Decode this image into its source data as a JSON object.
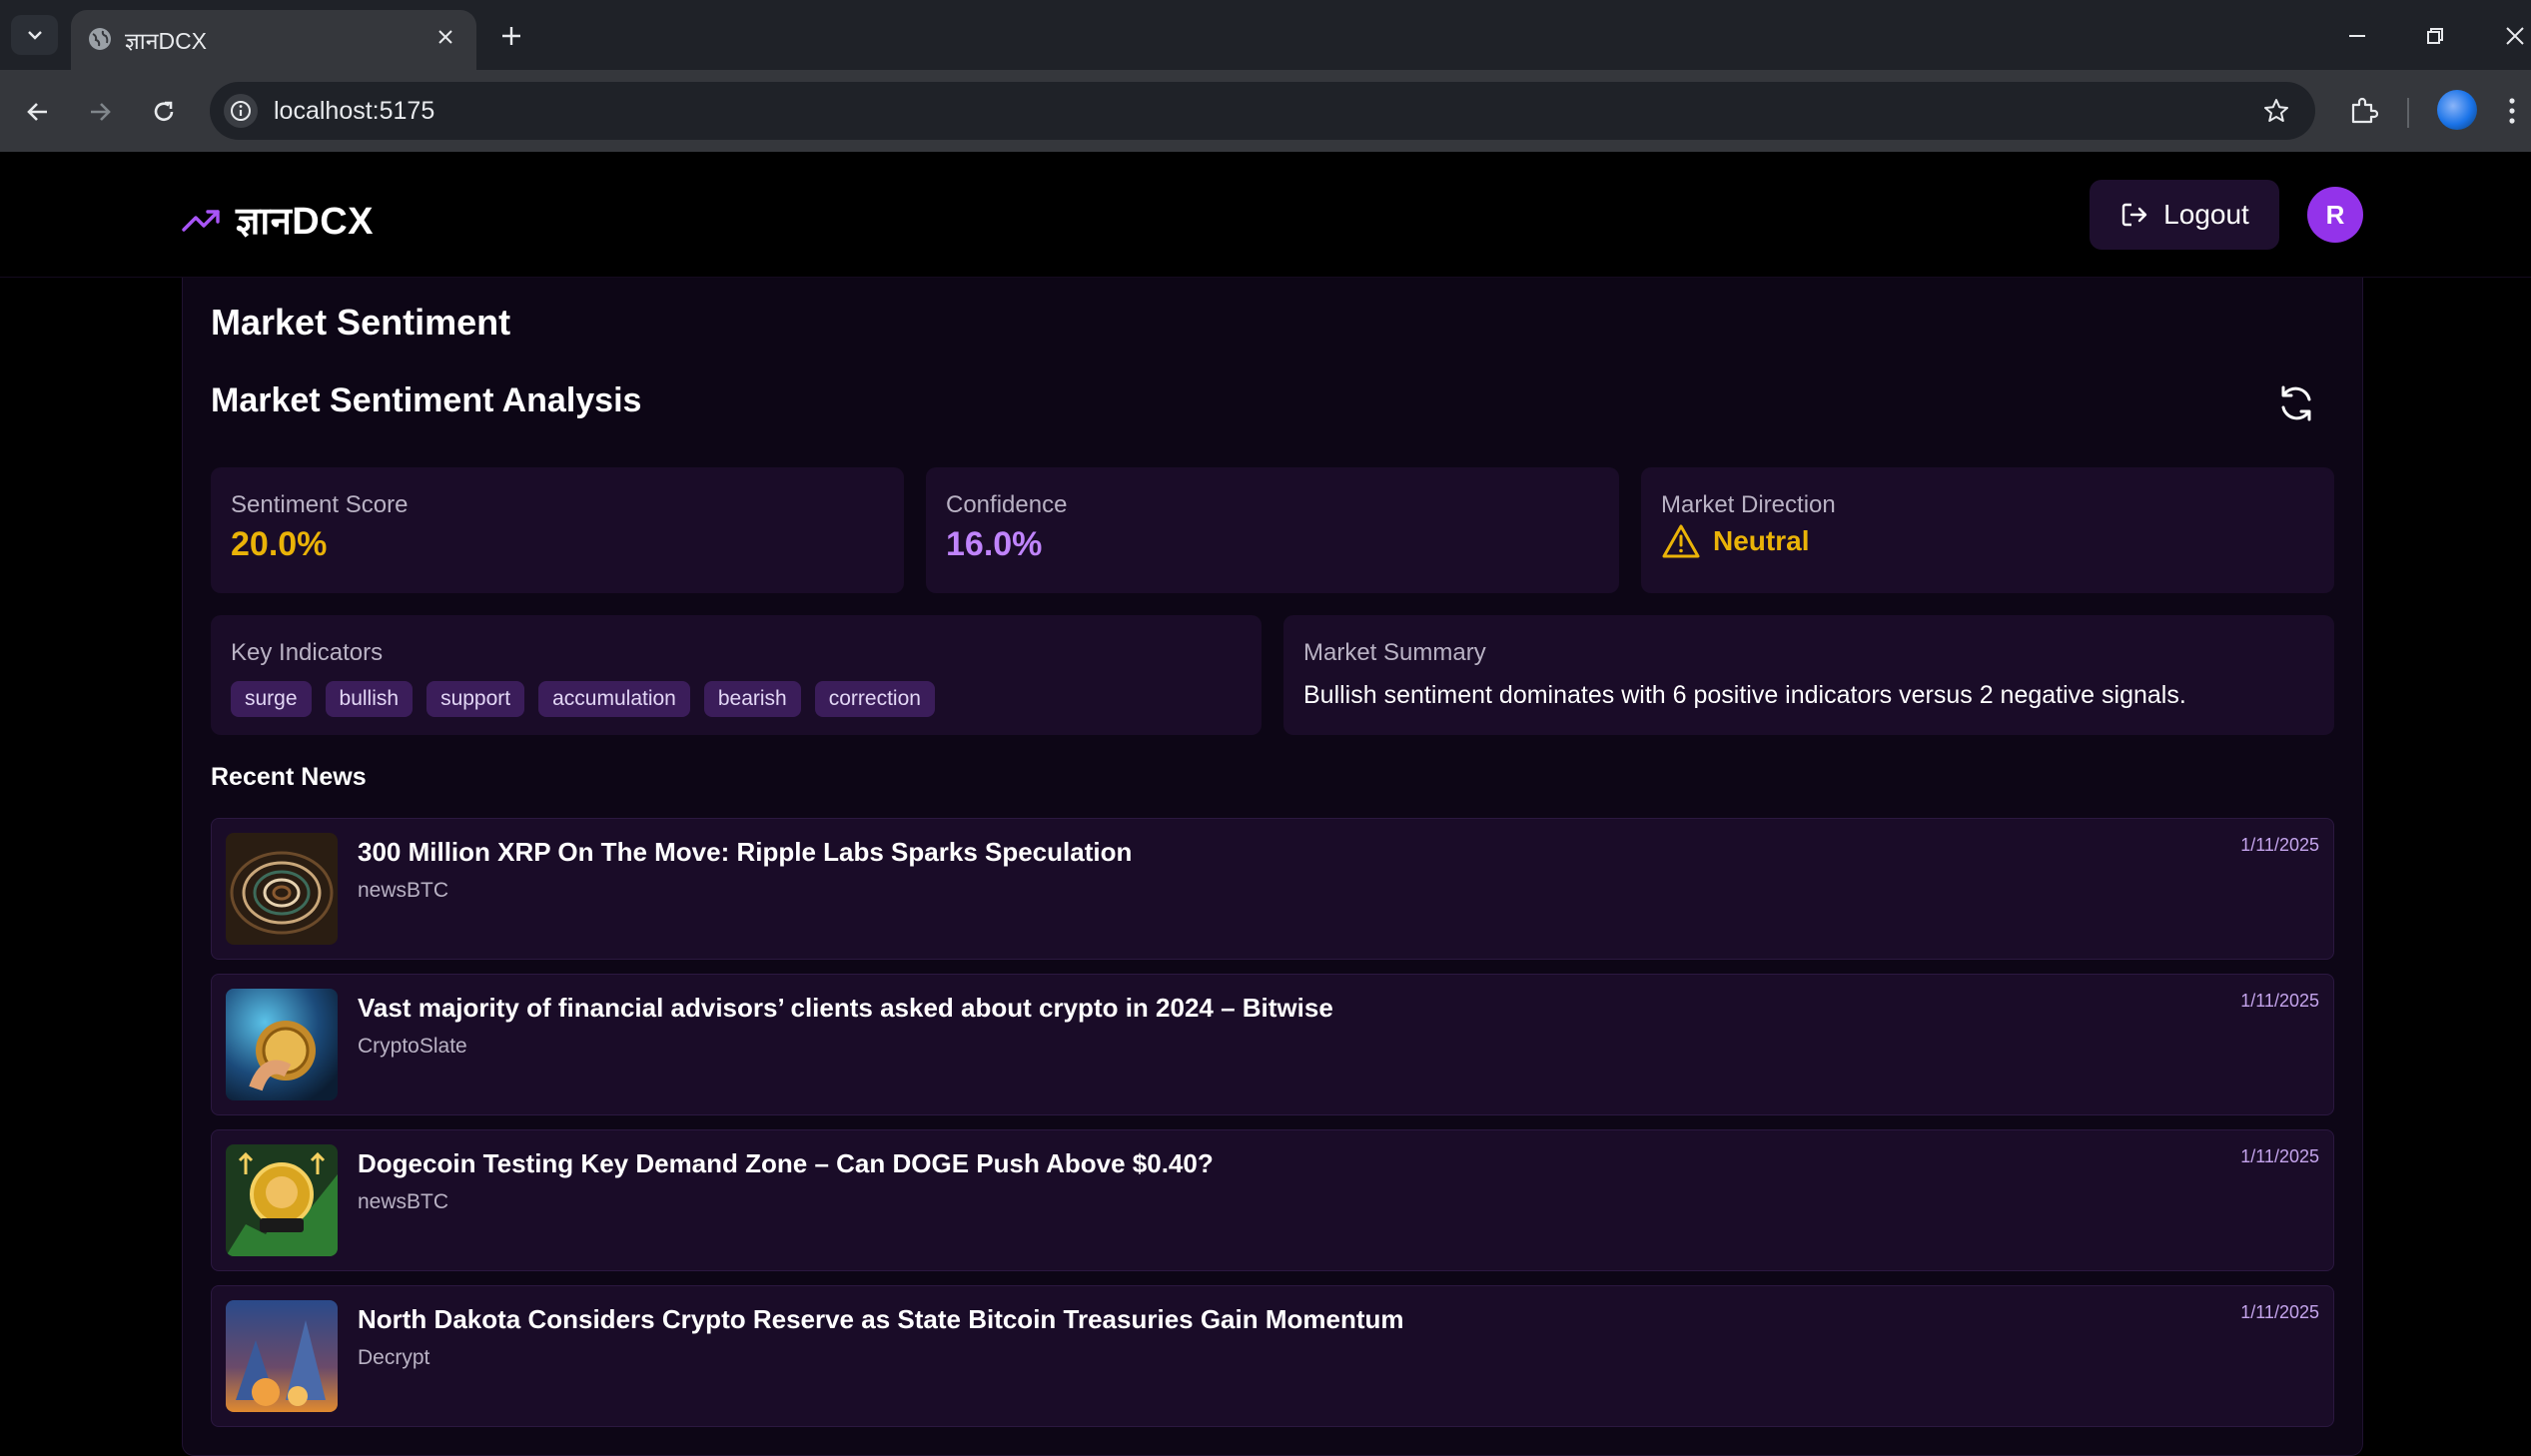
{
  "browser": {
    "tab_title": "ज्ञानDCX",
    "url": "localhost:5175"
  },
  "header": {
    "brand": "ज्ञानDCX",
    "logout_label": "Logout",
    "avatar_initial": "R"
  },
  "page": {
    "title": "Market Sentiment",
    "section_title": "Market Sentiment Analysis"
  },
  "metrics": {
    "sentiment": {
      "label": "Sentiment Score",
      "value": "20.0%",
      "color": "#eab308"
    },
    "confidence": {
      "label": "Confidence",
      "value": "16.0%",
      "color": "#c084fc"
    },
    "direction": {
      "label": "Market Direction",
      "value": "Neutral",
      "color": "#eab308",
      "icon": "warning-icon"
    }
  },
  "indicators": {
    "label": "Key Indicators",
    "items": [
      "surge",
      "bullish",
      "support",
      "accumulation",
      "bearish",
      "correction"
    ]
  },
  "summary": {
    "label": "Market Summary",
    "text": "Bullish sentiment dominates with 6 positive indicators versus 2 negative signals."
  },
  "news": {
    "heading": "Recent News",
    "items": [
      {
        "headline": "300 Million XRP On The Move: Ripple Labs Sparks Speculation",
        "source": "newsBTC",
        "date": "1/11/2025"
      },
      {
        "headline": "Vast majority of financial advisors’ clients asked about crypto in 2024 – Bitwise",
        "source": "CryptoSlate",
        "date": "1/11/2025"
      },
      {
        "headline": "Dogecoin Testing Key Demand Zone – Can DOGE Push Above $0.40?",
        "source": "newsBTC",
        "date": "1/11/2025"
      },
      {
        "headline": "North Dakota Considers Crypto Reserve as State Bitcoin Treasuries Gain Momentum",
        "source": "Decrypt",
        "date": "1/11/2025"
      }
    ]
  },
  "colors": {
    "accent": "#9333ea",
    "panel": "#0d0616",
    "card": "#1a0c28",
    "chip": "#3b1d5a"
  }
}
